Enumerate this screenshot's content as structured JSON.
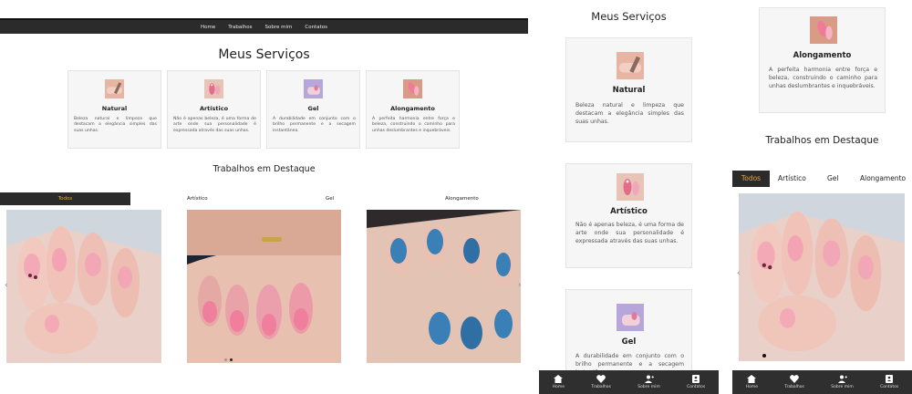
{
  "nav": {
    "items": [
      "Home",
      "Trabalhos",
      "Sobre mim",
      "Contatos"
    ]
  },
  "services": {
    "title": "Meus Serviços",
    "cards": [
      {
        "title": "Natural",
        "desc": "Beleza natural e limpeza que destacam a elegância simples das suas unhas.",
        "icon": "natural-nail-icon"
      },
      {
        "title": "Artístico",
        "desc": "Não é apenas beleza, é uma forma de arte onde sua personalidade é expressada através das suas unhas.",
        "icon": "artistic-nail-icon"
      },
      {
        "title": "Gel",
        "desc": "A durabilidade em conjunto com o brilho permanente e a secagem instantânea.",
        "icon": "gel-nail-icon"
      },
      {
        "title": "Alongamento",
        "desc": "A perfeita harmonia entre força e beleza, construindo o caminho para unhas deslumbrantes e inquebráveis.",
        "icon": "extension-nail-icon"
      }
    ]
  },
  "gallery": {
    "title": "Trabalhos em Destaque",
    "tabs": [
      "Todos",
      "Artístico",
      "Gel",
      "Alongamento"
    ],
    "active_tab": "Todos",
    "nav_prev": "‹",
    "nav_next": "›",
    "slide_count": 2,
    "active_slide": 2
  },
  "mobile_nav": {
    "items": [
      {
        "label": "Home",
        "icon": "home-icon"
      },
      {
        "label": "Trabalhos",
        "icon": "heart-icon"
      },
      {
        "label": "Sobre mim",
        "icon": "user-add-icon"
      },
      {
        "label": "Contatos",
        "icon": "contacts-icon"
      }
    ]
  },
  "colors": {
    "nav_bg": "#2b2b2b",
    "accent": "#e0a64a",
    "card_bg": "#f6f6f6"
  }
}
